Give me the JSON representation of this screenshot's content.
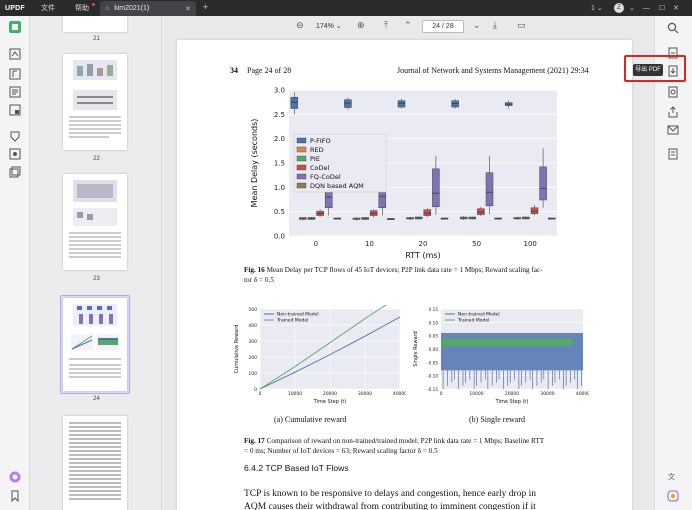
{
  "titlebar": {
    "logo": "UPDF",
    "menu": [
      "文件",
      "帮助"
    ],
    "tab_title": "kim2021(1)",
    "add_tab": "+",
    "version_badge": "1",
    "avatar_letter": "Z"
  },
  "toolbar": {
    "zoom": "174%",
    "page_current": "24",
    "page_sep": "/",
    "page_total": "28"
  },
  "thumbnails": [
    {
      "label": "21"
    },
    {
      "label": "22"
    },
    {
      "label": "23"
    },
    {
      "label": "24"
    }
  ],
  "rightbar": {
    "tooltip": "导出 PDF"
  },
  "document": {
    "header_page_num": "34",
    "header_page_of": "Page 24 of 28",
    "header_journal": "Journal of Network and Systems Management (2021) 29:34",
    "fig16_caption_label": "Fig. 16",
    "fig16_caption": "Mean Delay per TCP flows of 45 IoT devices; P2P link data rate = 1 Mbps; Reward scaling fac-",
    "fig16_caption_2": "tor δ = 0.5",
    "fig17_caption_label": "Fig. 17",
    "fig17_caption": "Comparison of reward on non-trained/trained model; P2P link data rate = 1 Mbps; Baseline RTT",
    "fig17_caption_2": "= 0 ms; Number of IoT devices = 63; Reward scaling factor δ = 0.5",
    "sub_a": "(a) Cumulative reward",
    "sub_b": "(b) Single reward",
    "section": "6.4.2  TCP Based IoT Flows",
    "body_line1": "TCP is known to be responsive to delays and congestion, hence early drop in",
    "body_line2": "AQM causes their withdrawal from contributing to imminent congestion if it"
  },
  "chart_data": [
    {
      "type": "box",
      "ylabel": "Mean Delay (seconds)",
      "xlabel": "RTT (ms)",
      "categories": [
        "0",
        "10",
        "20",
        "50",
        "100"
      ],
      "ylim": [
        0.0,
        3.0
      ],
      "yticks": [
        "0.0",
        "0.5",
        "1.0",
        "1.5",
        "2.0",
        "2.5",
        "3.0"
      ],
      "legend_position": "left-center",
      "series": [
        {
          "name": "P-FIFO",
          "color": "#4c72b0",
          "median": [
            2.75,
            2.73,
            2.73,
            2.72,
            2.71
          ],
          "q1": [
            2.62,
            2.64,
            2.65,
            2.65,
            2.68
          ],
          "q3": [
            2.85,
            2.8,
            2.78,
            2.78,
            2.74
          ],
          "wmin": [
            2.5,
            2.6,
            2.62,
            2.62,
            2.62
          ],
          "wmax": [
            2.95,
            2.85,
            2.82,
            2.82,
            2.78
          ]
        },
        {
          "name": "RED",
          "color": "#dd8452",
          "median": [
            0.36,
            0.35,
            0.36,
            0.37,
            0.36
          ],
          "q1": [
            0.34,
            0.34,
            0.35,
            0.35,
            0.35
          ],
          "q3": [
            0.38,
            0.37,
            0.38,
            0.39,
            0.38
          ],
          "wmin": [
            0.32,
            0.32,
            0.33,
            0.33,
            0.34
          ],
          "wmax": [
            0.39,
            0.38,
            0.39,
            0.41,
            0.4
          ]
        },
        {
          "name": "PIE",
          "color": "#55a868",
          "median": [
            0.36,
            0.36,
            0.37,
            0.37,
            0.37
          ],
          "q1": [
            0.34,
            0.34,
            0.35,
            0.35,
            0.35
          ],
          "q3": [
            0.38,
            0.38,
            0.39,
            0.39,
            0.39
          ],
          "wmin": [
            0.33,
            0.33,
            0.34,
            0.34,
            0.34
          ],
          "wmax": [
            0.39,
            0.39,
            0.4,
            0.4,
            0.4
          ]
        },
        {
          "name": "CoDel",
          "color": "#c44e52",
          "median": [
            0.46,
            0.46,
            0.47,
            0.49,
            0.51
          ],
          "q1": [
            0.42,
            0.42,
            0.42,
            0.44,
            0.46
          ],
          "q3": [
            0.51,
            0.52,
            0.54,
            0.56,
            0.58
          ],
          "wmin": [
            0.39,
            0.38,
            0.39,
            0.41,
            0.43
          ],
          "wmax": [
            0.55,
            0.55,
            0.57,
            0.6,
            0.64
          ]
        },
        {
          "name": "FQ-CoDel",
          "color": "#8172b3",
          "median": [
            0.8,
            0.82,
            0.88,
            0.9,
            0.98
          ],
          "q1": [
            0.58,
            0.58,
            0.6,
            0.62,
            0.74
          ],
          "q3": [
            1.22,
            1.42,
            1.38,
            1.3,
            1.42
          ],
          "wmin": [
            0.42,
            0.42,
            0.44,
            0.45,
            0.58
          ],
          "wmax": [
            1.6,
            1.6,
            1.65,
            1.65,
            1.8
          ]
        },
        {
          "name": "DQN based AQM",
          "color": "#937860",
          "median": [
            0.36,
            0.35,
            0.36,
            0.36,
            0.36
          ],
          "q1": [
            0.35,
            0.34,
            0.35,
            0.35,
            0.35
          ],
          "q3": [
            0.37,
            0.36,
            0.37,
            0.37,
            0.37
          ],
          "wmin": [
            0.34,
            0.33,
            0.34,
            0.34,
            0.34
          ],
          "wmax": [
            0.38,
            0.37,
            0.38,
            0.38,
            0.38
          ]
        }
      ]
    },
    {
      "type": "line",
      "xlabel": "Time Step (t)",
      "ylabel": "Cumulative Reward",
      "xlim": [
        0,
        40000
      ],
      "ylim": [
        0,
        500
      ],
      "xticks": [
        "0",
        "10000",
        "20000",
        "30000",
        "40000"
      ],
      "yticks": [
        "0",
        "100",
        "200",
        "300",
        "400",
        "500"
      ],
      "legend_position": "top-left",
      "series": [
        {
          "name": "Non-trained Model",
          "color": "#4c72b0",
          "x": [
            0,
            10000,
            20000,
            30000,
            40000
          ],
          "y": [
            0,
            105,
            215,
            330,
            450
          ]
        },
        {
          "name": "Trained Model",
          "color": "#55a868",
          "x": [
            0,
            10000,
            20000,
            30000,
            37000
          ],
          "y": [
            0,
            140,
            290,
            440,
            540
          ]
        }
      ]
    },
    {
      "type": "line",
      "xlabel": "Time Step (t)",
      "ylabel": "Single Reward",
      "xlim": [
        0,
        40000
      ],
      "ylim": [
        -0.15,
        0.15
      ],
      "xticks": [
        "0",
        "10000",
        "20000",
        "30000",
        "40000"
      ],
      "yticks": [
        "-0.15",
        "-0.10",
        "-0.05",
        "0.00",
        "0.05",
        "0.10",
        "0.15"
      ],
      "legend_position": "top-left",
      "series": [
        {
          "name": "Non-trained Model",
          "color": "#4c72b0",
          "band": [
            -0.08,
            0.06
          ],
          "spike_min": -0.15
        },
        {
          "name": "Trained Model",
          "color": "#55a868",
          "band": [
            0.01,
            0.04
          ],
          "x_end": 37000
        }
      ]
    }
  ]
}
